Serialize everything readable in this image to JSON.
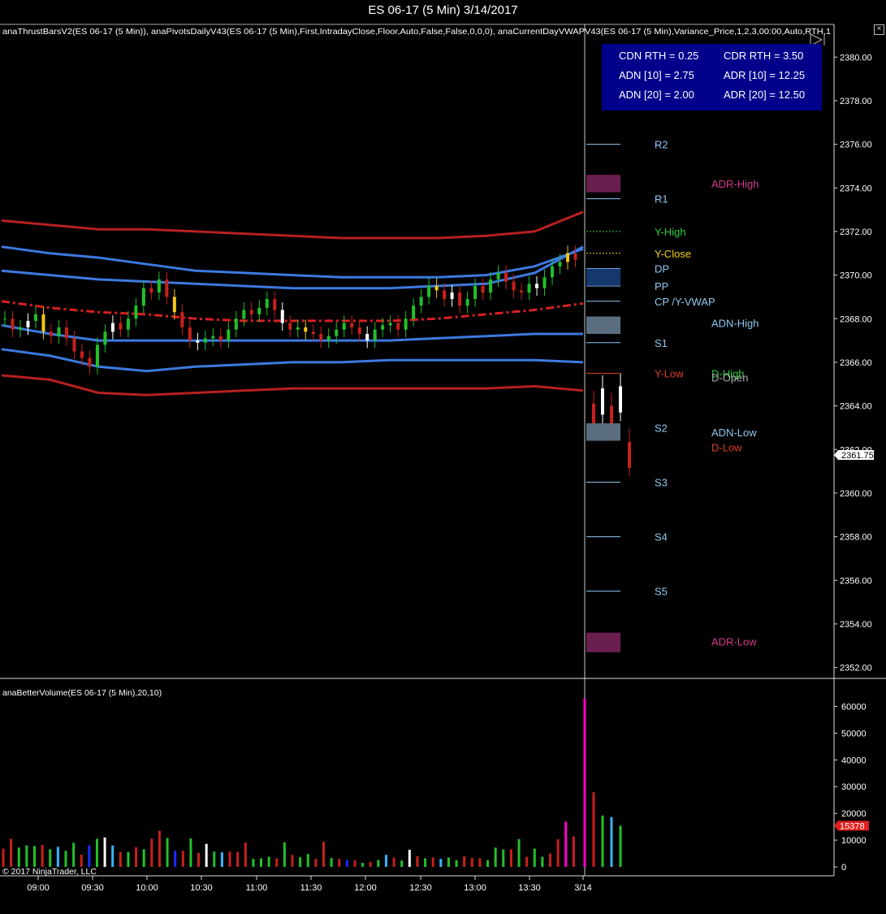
{
  "window": {
    "title": "ES 06-17 (5 Min)  3/14/2017",
    "close_glyph": "×",
    "indicator_line": "anaThrustBarsV2(ES 06-17 (5 Min)), anaPivotsDailyV43(ES 06-17 (5 Min),First,IntradayClose,Floor,Auto,False,False,0,0,0), anaCurrentDayVWAPV43(ES 06-17 (5 Min),Variance_Price,1,2,3,00:00,Auto,RTH,1",
    "volume_label": "anaBetterVolume(ES 06-17 (5 Min),20,10)",
    "copyright": "© 2017 NinjaTrader, LLC"
  },
  "stats": [
    {
      "text": "CDN RTH = 0.25"
    },
    {
      "text": "CDR RTH = 3.50"
    },
    {
      "text": "ADN [10] = 2.75"
    },
    {
      "text": "ADR [10] = 12.25"
    },
    {
      "text": "ADN [20] = 2.00"
    },
    {
      "text": "ADR [20] = 12.50"
    }
  ],
  "colors": {
    "up_candle": "#22c02a",
    "down_candle": "#c8201c",
    "white_candle": "#ffffff",
    "yellow_candle": "#f5c518",
    "vwap_band_inner": "#3c7ae0",
    "vwap_band_outer": "#b82020",
    "pivot_label": "#8fc8f0",
    "adr_label": "#d23c8c",
    "last_price_tag": "#ffffff",
    "volume_last_tag": "#e02020"
  },
  "chart_data": [
    {
      "type": "candlestick",
      "instrument": "ES 06-17 (5 Min)",
      "ylim": [
        2351.5,
        2381.5
      ],
      "y_ticks": [
        "2352.00",
        "2354.00",
        "2356.00",
        "2358.00",
        "2360.00",
        "2362.00",
        "2364.00",
        "2366.00",
        "2368.00",
        "2370.00",
        "2372.00",
        "2374.00",
        "2376.00",
        "2378.00",
        "2380.00"
      ],
      "x_ticks": [
        "09:00",
        "09:30",
        "10:00",
        "10:30",
        "11:00",
        "11:30",
        "12:00",
        "12:30",
        "13:00",
        "13:30",
        "3/14"
      ],
      "last_price": "2361.75",
      "closes": [
        2368.0,
        2367.5,
        2367.6,
        2367.9,
        2368.2,
        2367.4,
        2367.2,
        2367.6,
        2367.1,
        2366.5,
        2366.2,
        2365.8,
        2366.8,
        2367.4,
        2367.8,
        2367.5,
        2368.0,
        2368.6,
        2369.4,
        2369.2,
        2369.8,
        2369.0,
        2368.3,
        2367.6,
        2367.0,
        2366.9,
        2367.1,
        2367.2,
        2367.0,
        2367.5,
        2368.0,
        2368.4,
        2368.2,
        2368.5,
        2368.9,
        2368.4,
        2367.8,
        2367.5,
        2367.6,
        2367.4,
        2367.3,
        2367.0,
        2367.2,
        2367.5,
        2367.8,
        2367.6,
        2367.3,
        2367.0,
        2367.5,
        2367.7,
        2367.8,
        2367.5,
        2368.0,
        2368.6,
        2369.0,
        2369.5,
        2369.3,
        2368.9,
        2369.2,
        2368.6,
        2368.9,
        2369.5,
        2369.2,
        2369.8,
        2370.1,
        2369.7,
        2369.3,
        2369.2,
        2369.6,
        2369.4,
        2369.9,
        2370.4,
        2370.6,
        2371.0,
        2370.7
      ],
      "session_candles": [
        2363.5,
        2364.2,
        2363.4,
        2364.3,
        2361.75
      ],
      "volume_pane": {
        "ylim": [
          0,
          65000
        ],
        "y_ticks": [
          "0",
          "10000",
          "20000",
          "30000",
          "40000",
          "50000",
          "60000"
        ],
        "last_value": "15378"
      },
      "volumes": [
        6800,
        10500,
        7200,
        8000,
        7800,
        8200,
        6600,
        7500,
        6000,
        9000,
        4600,
        8000,
        10500,
        11000,
        8000,
        5600,
        5600,
        7400,
        6600,
        10600,
        13500,
        10800,
        6000,
        6000,
        10600,
        5200,
        8600,
        5700,
        5400,
        5700,
        5600,
        9200,
        3000,
        3200,
        3800,
        3200,
        9200,
        4500,
        3600,
        4800,
        3000,
        9400,
        3300,
        3000,
        2600,
        2400,
        1500,
        1800,
        2600,
        4500,
        3500,
        2400,
        6400,
        4000,
        3200,
        3500,
        3000,
        3500,
        2500,
        4000,
        3400,
        3200,
        2500,
        7200,
        6500,
        6600,
        10400,
        3800,
        6800,
        3800,
        5000,
        10300,
        16900,
        11400,
        63000,
        27900,
        19200,
        18600,
        15378
      ],
      "levels": [
        {
          "label": "R2",
          "price": 2376.0
        },
        {
          "label": "R1",
          "price": 2373.5
        },
        {
          "label": "Y-High",
          "price": 2372.0
        },
        {
          "label": "Y-Close",
          "price": 2371.0
        },
        {
          "label": "DP",
          "price": 2370.3
        },
        {
          "label": "PP",
          "price": 2369.5
        },
        {
          "label": "CP /Y-VWAP",
          "price": 2368.8
        },
        {
          "label": "S1",
          "price": 2366.9
        },
        {
          "label": "Y-Low",
          "price": 2365.5
        },
        {
          "label": "S2",
          "price": 2363.0
        },
        {
          "label": "S3",
          "price": 2360.5
        },
        {
          "label": "S4",
          "price": 2358.0
        },
        {
          "label": "S5",
          "price": 2355.5
        }
      ],
      "adr_labels": [
        {
          "label": "ADR-High",
          "price": 2374.2
        },
        {
          "label": "ADN-High",
          "price": 2367.8
        },
        {
          "label": "D-High",
          "price": 2365.5
        },
        {
          "label": "D-Open",
          "price": 2365.3
        },
        {
          "label": "ADN-Low",
          "price": 2362.8
        },
        {
          "label": "D-Low",
          "price": 2362.1
        },
        {
          "label": "ADR-Low",
          "price": 2353.2
        }
      ],
      "vwap_center": [
        2368.8,
        2368.5,
        2368.3,
        2368.2,
        2368.0,
        2367.9,
        2367.9,
        2367.9,
        2367.9,
        2368.0,
        2368.2,
        2368.4,
        2368.7
      ],
      "band_inner_upper": [
        2371.3,
        2371.0,
        2370.8,
        2370.5,
        2370.2,
        2370.1,
        2370.0,
        2369.9,
        2369.9,
        2369.9,
        2370.0,
        2370.4,
        2371.2
      ],
      "band_inner_lower": [
        2367.7,
        2367.3,
        2367.0,
        2367.0,
        2367.0,
        2367.0,
        2367.0,
        2367.0,
        2367.0,
        2367.1,
        2367.2,
        2367.3,
        2367.3
      ],
      "band_outer_upper": [
        2372.5,
        2372.3,
        2372.1,
        2372.1,
        2372.0,
        2371.9,
        2371.8,
        2371.7,
        2371.7,
        2371.7,
        2371.8,
        2372.0,
        2372.9
      ],
      "band_inner2_upper": [
        2370.2,
        2370.0,
        2369.8,
        2369.7,
        2369.6,
        2369.5,
        2369.4,
        2369.4,
        2369.4,
        2369.5,
        2369.6,
        2370.1,
        2371.3
      ],
      "band_inner2_lower": [
        2366.6,
        2366.3,
        2365.8,
        2365.6,
        2365.8,
        2365.9,
        2366.0,
        2366.0,
        2366.1,
        2366.1,
        2366.1,
        2366.1,
        2366.0
      ],
      "band_outer_lower": [
        2365.4,
        2365.2,
        2364.6,
        2364.5,
        2364.6,
        2364.7,
        2364.8,
        2364.8,
        2364.8,
        2364.8,
        2364.8,
        2364.9,
        2364.7
      ]
    }
  ]
}
